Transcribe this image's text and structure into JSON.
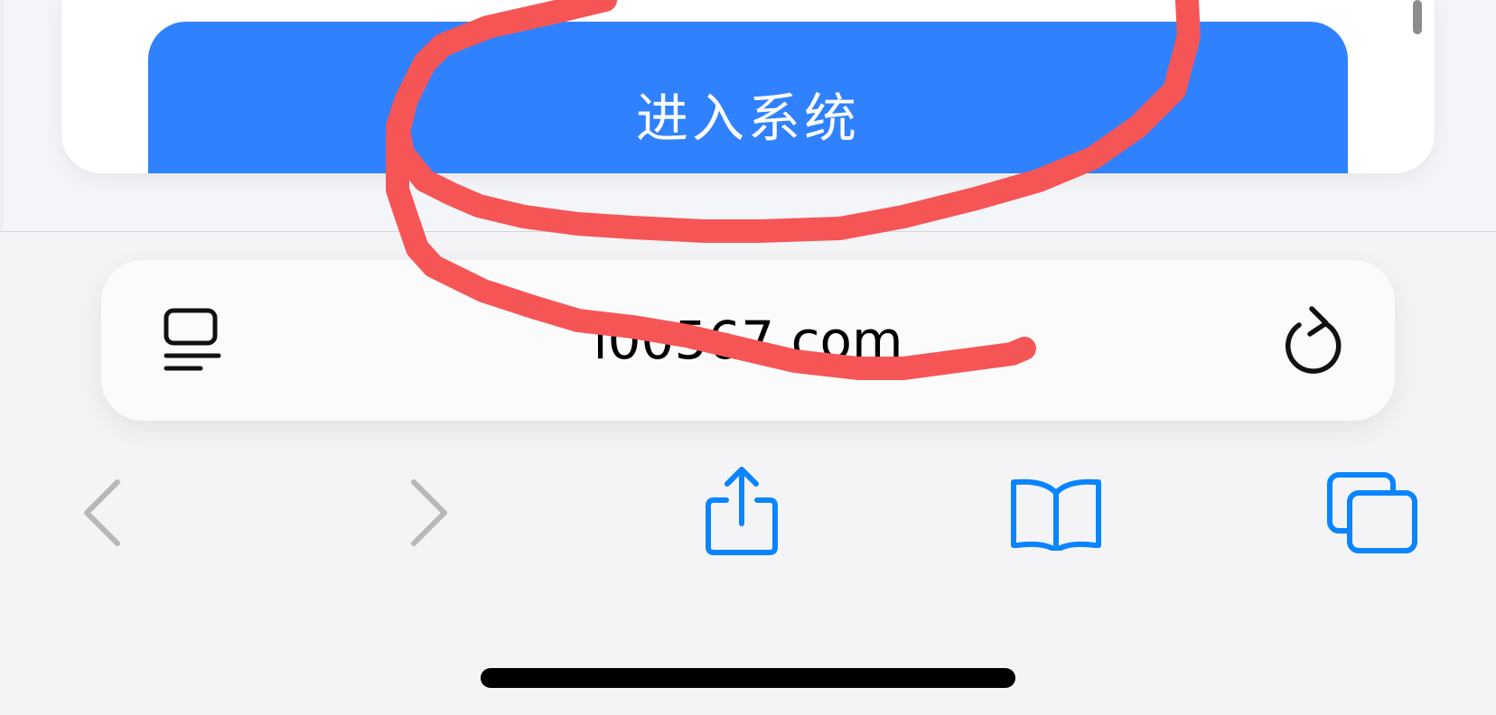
{
  "web_page": {
    "enter_button_label": "进入系统"
  },
  "browser": {
    "url": "l00567.com",
    "toolbar": {
      "back_icon": "chevron-left-icon",
      "forward_icon": "chevron-right-icon",
      "share_icon": "share-icon",
      "bookmarks_icon": "book-icon",
      "tabs_icon": "tabs-icon"
    },
    "address_bar": {
      "reader_icon": "reader-format-icon",
      "reload_icon": "reload-icon"
    }
  },
  "colors": {
    "accent_blue": "#3081fd",
    "ios_blue": "#0a84ff",
    "disabled_gray": "#b8b8bc",
    "annotation_red": "#f65556"
  },
  "annotation": {
    "type": "freehand-red-circle-scribble"
  }
}
